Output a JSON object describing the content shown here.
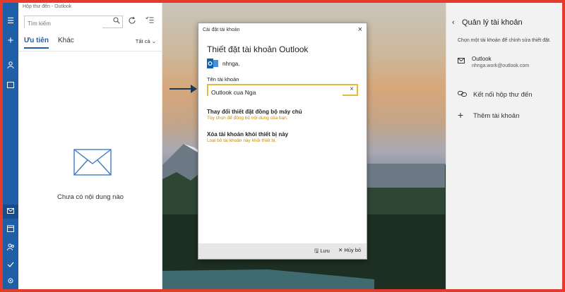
{
  "window": {
    "title": "Hộp thư đến - Outlook",
    "controls": [
      "—",
      "☐",
      "✕"
    ]
  },
  "rail": {
    "items": [
      {
        "icon": "menu-icon",
        "glyph": "☰"
      },
      {
        "icon": "compose-icon",
        "glyph": "+"
      },
      {
        "icon": "person-icon",
        "glyph": "👤"
      },
      {
        "icon": "folder-icon",
        "glyph": "▭"
      },
      {
        "icon": "mail-icon",
        "glyph": "✉"
      },
      {
        "icon": "calendar-icon",
        "glyph": "▦"
      },
      {
        "icon": "people-icon",
        "glyph": "👥"
      },
      {
        "icon": "todo-icon",
        "glyph": "✔"
      },
      {
        "icon": "settings-icon",
        "glyph": "⚙"
      }
    ]
  },
  "pane": {
    "search_placeholder": "Tìm kiếm",
    "tab_focused": "Ưu tiên",
    "tab_other": "Khác",
    "sort_label": "Tất cả ⌄",
    "empty_text": "Chưa có nội dung nào"
  },
  "dialog": {
    "title": "Cài đặt tài khoản",
    "heading": "Thiết đặt tài khoản Outlook",
    "account_name": "nhnga.",
    "field_label": "Tên tài khoản",
    "field_value": "Outlook cua Nga",
    "sync_title": "Thay đổi thiết đặt đồng bộ máy chủ",
    "sync_desc": "Tùy chọn để đồng bộ nội dung của bạn.",
    "remove_title": "Xóa tài khoản khỏi thiết bị này",
    "remove_desc": "Loại bỏ tài khoản này khỏi thiết bị.",
    "save_label": "Lưu",
    "cancel_label": "Hủy bỏ"
  },
  "manage": {
    "title": "Quản lý tài khoản",
    "subtitle": "Chọn một tài khoản để chỉnh sửa thiết đặt.",
    "account_title": "Outlook",
    "account_email": "nhnga.work@outlook.com",
    "link_inboxes": "Kết nối hộp thư đến",
    "add_account": "Thêm tài khoản"
  },
  "colors": {
    "accent": "#1f5fa8",
    "frame": "#e53b2c",
    "highlight": "#e9b93d",
    "hint": "#c08a10"
  }
}
